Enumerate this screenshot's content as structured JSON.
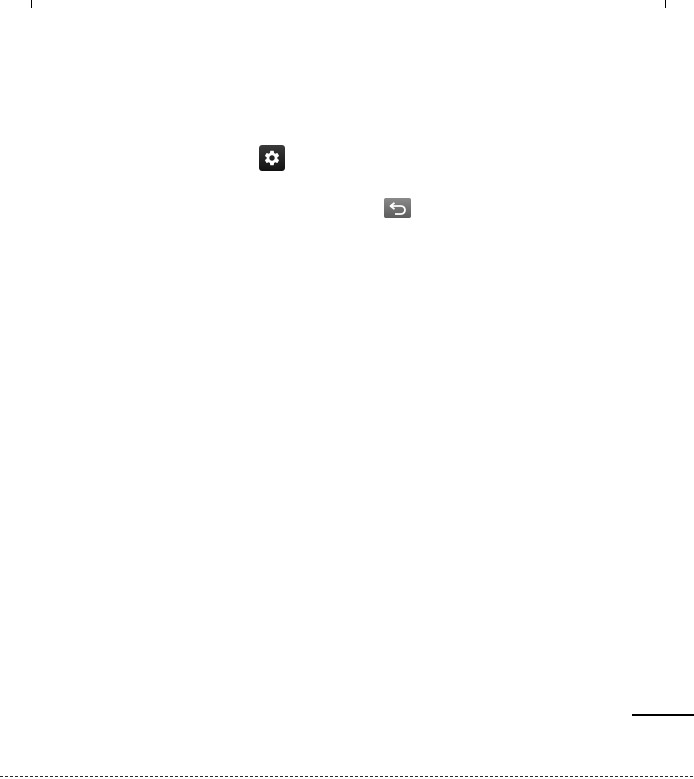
{
  "icons": {
    "settings": "gear-icon",
    "back": "back-arrow-icon"
  },
  "colors": {
    "settings_key": "#1c1c1c",
    "back_key": "#6e6e6e",
    "icon_glyph": "#ffffff",
    "rule": "#000000"
  }
}
